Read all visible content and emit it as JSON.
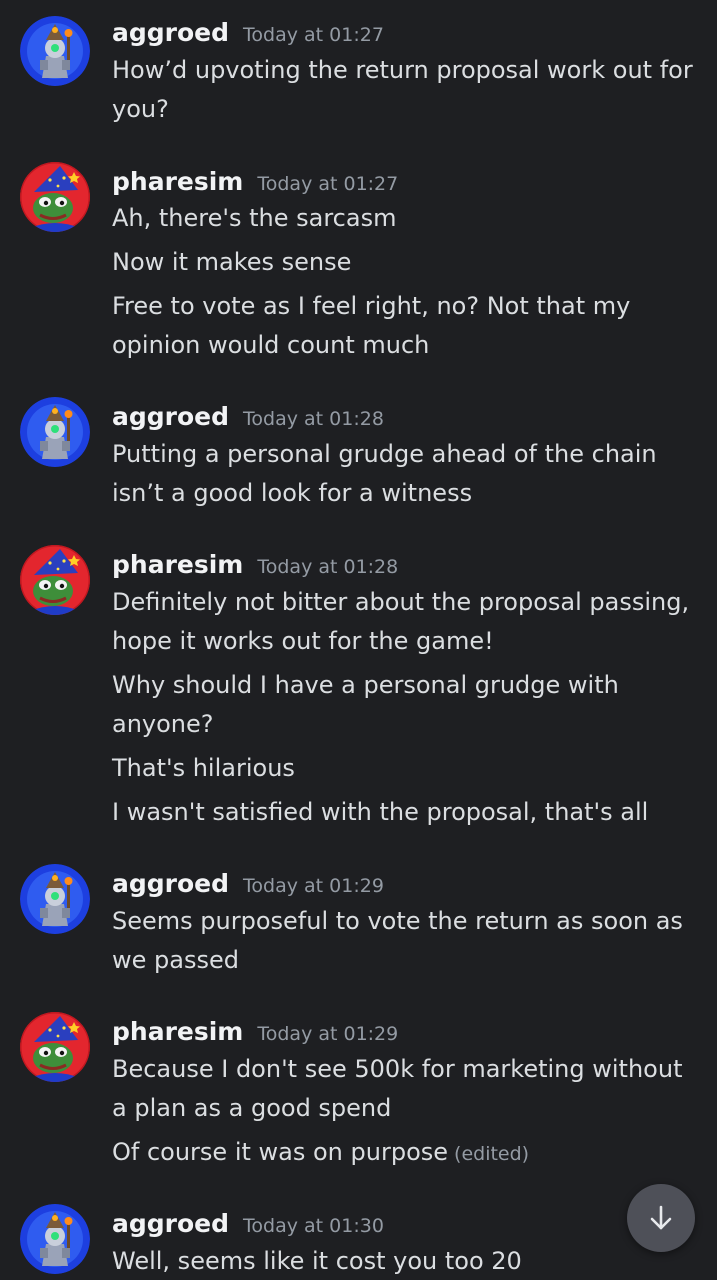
{
  "messages": [
    {
      "author": "aggroed",
      "avatar_icon": "wizard-robot-avatar-icon",
      "timestamp": "Today at 01:27",
      "lines": [
        "How’d upvoting the return proposal work out for",
        "you?"
      ]
    },
    {
      "author": "pharesim",
      "avatar_icon": "pepe-wizard-avatar-icon",
      "timestamp": "Today at 01:27",
      "lines": [
        "Ah, there's the sarcasm",
        "Now it makes sense",
        "Free to vote as I feel right, no? Not that my",
        "opinion would count much"
      ]
    },
    {
      "author": "aggroed",
      "avatar_icon": "wizard-robot-avatar-icon",
      "timestamp": "Today at 01:28",
      "lines": [
        "Putting a personal grudge ahead of the chain",
        "isn’t a good look for a witness"
      ]
    },
    {
      "author": "pharesim",
      "avatar_icon": "pepe-wizard-avatar-icon",
      "timestamp": "Today at 01:28",
      "lines": [
        "Definitely not bitter about the proposal passing,",
        "hope it works out for the game!",
        "Why should I have a personal grudge with",
        "anyone?",
        "That's hilarious",
        "I wasn't satisfied with the proposal, that's all"
      ]
    },
    {
      "author": "aggroed",
      "avatar_icon": "wizard-robot-avatar-icon",
      "timestamp": "Today at 01:29",
      "lines": [
        "Seems purposeful to vote the return as soon as",
        "we passed"
      ]
    },
    {
      "author": "pharesim",
      "avatar_icon": "pepe-wizard-avatar-icon",
      "timestamp": "Today at 01:29",
      "lines": [
        "Because I don't see 500k for marketing without",
        "a plan as a good spend",
        "Of course it was on purpose"
      ],
      "edited_label": "(edited)"
    },
    {
      "author": "aggroed",
      "avatar_icon": "wizard-robot-avatar-icon",
      "timestamp": "Today at 01:30",
      "lines": [
        "Well, seems like it cost you too 20"
      ]
    }
  ],
  "scroll_button": {
    "icon": "arrow-down-icon"
  },
  "colors": {
    "background": "#1e1f22",
    "username": "#f2f3f5",
    "timestamp": "#949ba4",
    "text": "#dbdee1",
    "scroll_button": "#4e5058"
  }
}
